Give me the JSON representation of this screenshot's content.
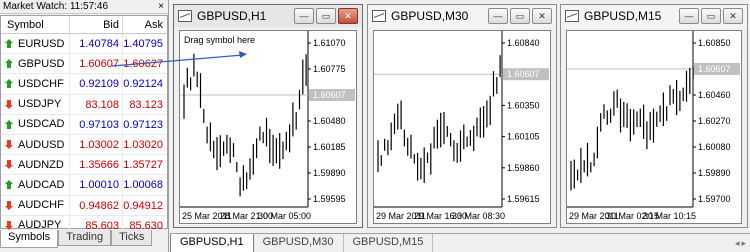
{
  "market_watch": {
    "title": "Market Watch: 11:57:46",
    "close_glyph": "×",
    "columns": {
      "symbol": "Symbol",
      "bid": "Bid",
      "ask": "Ask"
    },
    "rows": [
      {
        "symbol": "EURUSD",
        "bid": "1.40784",
        "ask": "1.40795",
        "dir": "up",
        "color": "blue"
      },
      {
        "symbol": "GBPUSD",
        "bid": "1.60607",
        "ask": "1.60627",
        "dir": "up",
        "color": "red",
        "selected": true
      },
      {
        "symbol": "USDCHF",
        "bid": "0.92109",
        "ask": "0.92124",
        "dir": "up",
        "color": "blue"
      },
      {
        "symbol": "USDJPY",
        "bid": "83.108",
        "ask": "83.123",
        "dir": "down",
        "color": "red"
      },
      {
        "symbol": "USDCAD",
        "bid": "0.97103",
        "ask": "0.97123",
        "dir": "up",
        "color": "blue"
      },
      {
        "symbol": "AUDUSD",
        "bid": "1.03002",
        "ask": "1.03020",
        "dir": "down",
        "color": "red"
      },
      {
        "symbol": "AUDNZD",
        "bid": "1.35666",
        "ask": "1.35727",
        "dir": "down",
        "color": "red"
      },
      {
        "symbol": "AUDCAD",
        "bid": "1.00010",
        "ask": "1.00068",
        "dir": "up",
        "color": "blue"
      },
      {
        "symbol": "AUDCHF",
        "bid": "0.94862",
        "ask": "0.94912",
        "dir": "down",
        "color": "red"
      },
      {
        "symbol": "AUDJPY",
        "bid": "85.603",
        "ask": "85.630",
        "dir": "down",
        "color": "red"
      }
    ],
    "tabs": [
      "Symbols",
      "Trading",
      "Ticks"
    ],
    "active_tab": "Symbols"
  },
  "windows": [
    {
      "title": "GBPUSD,H1",
      "active": true,
      "hint": "Drag symbol here",
      "price_labels": [
        "1.61070",
        "1.60775",
        "1.60607",
        "1.60480",
        "1.60185",
        "1.59890",
        "1.59595"
      ],
      "current_price": "1.60607",
      "time_labels": [
        "25 Mar 2011",
        "28 Mar 21:00",
        "30 Mar 05:00"
      ]
    },
    {
      "title": "GBPUSD,M30",
      "active": false,
      "price_labels": [
        "1.60840",
        "1.60607",
        "1.60350",
        "1.60105",
        "1.59860",
        "1.59615"
      ],
      "current_price": "1.60607",
      "time_labels": [
        "29 Mar 2011",
        "29 Mar 16:30",
        "30 Mar 08:30"
      ]
    },
    {
      "title": "GBPUSD,M15",
      "active": false,
      "price_labels": [
        "1.60850",
        "1.60607",
        "1.60460",
        "1.60270",
        "1.60080",
        "1.59890",
        "1.59700"
      ],
      "current_price": "1.60607",
      "time_labels": [
        "29 Mar 2011",
        "30 Mar 02:15",
        "30 Mar 10:15"
      ]
    }
  ],
  "bottom_tabs": [
    "GBPUSD,H1",
    "GBPUSD,M30",
    "GBPUSD,M15"
  ],
  "active_bottom_tab": "GBPUSD,H1",
  "colors": {
    "bid_up": "#0000c8",
    "bid_down": "#c80000",
    "arrow_up": "#2a9a2a",
    "arrow_down": "#e04020",
    "drag_arrow": "#3060b0",
    "current_price_bg": "#c0c0c0"
  },
  "window_buttons": {
    "minimize": "—",
    "maximize": "▭",
    "close": "✕"
  },
  "scroll_left": "◂",
  "scroll_right": "▸"
}
